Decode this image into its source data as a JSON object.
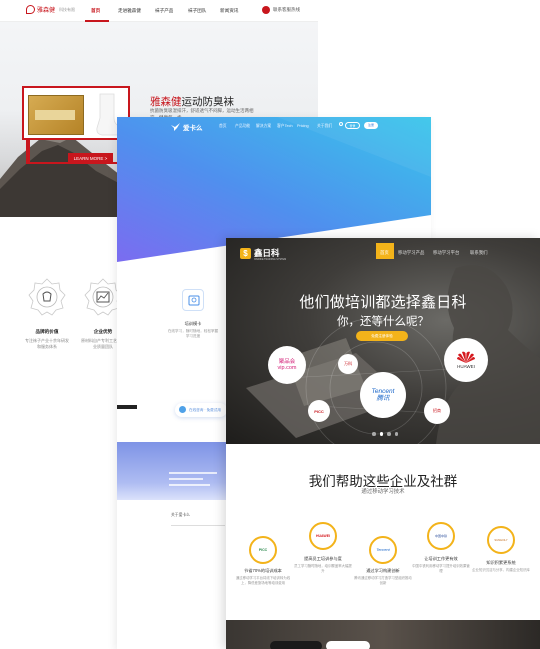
{
  "card1": {
    "logo_text": "雅森健",
    "logo_sub": "科技有限",
    "nav": [
      "首页",
      "走进雅森健",
      "袜子产品",
      "袜子团队",
      "新闻资讯"
    ],
    "hotline": "联系客服热线",
    "hero": {
      "brand": "雅森健",
      "title_rest": "运动防臭袜",
      "desc": "抗菌防臭吸湿排汗，舒适透气不闷脚，运动生活两相宜，健康每一步",
      "button": "LEARN MORE >"
    },
    "features": [
      {
        "title": "品牌的价值",
        "desc": "专注袜子产业十余年研发和服务体系",
        "icon": "socks-icon"
      },
      {
        "title": "企业优势",
        "desc": "原材料自产专利工艺，专业质量团队",
        "icon": "chart-icon"
      }
    ],
    "colors": {
      "accent": "#c8161d"
    }
  },
  "card2": {
    "logo_text": "爱卡么",
    "nav": [
      "首页",
      "产品功能",
      "解决方案",
      "客户Tech",
      "Pricing",
      "关于我们",
      "联系我们"
    ],
    "btn_login": "登录",
    "btn_register": "注册",
    "feature": {
      "title": "培训模卡",
      "desc": "在线学习，随时随地，轻松掌握学习进度"
    },
    "pill": "在线咨询 · 免费试用",
    "footer": "关于爱卡么",
    "colors": {
      "gradient_start": "#7b6cf0",
      "gradient_end": "#38c6ea"
    }
  },
  "card3": {
    "logo_text": "鑫日科",
    "logo_sub": "XINRIKE TRAINING SYSTEM",
    "nav": [
      "首页",
      "移动学习产品",
      "移动学习平台",
      "联系我们"
    ],
    "headline": "他们做培训都选择鑫日科",
    "subheadline": "你，还等什么呢？",
    "cta": "免费注册体验",
    "bubbles": [
      {
        "text": "聚品会\nvip.com",
        "icon": "vipshop-logo"
      },
      {
        "text": "万科",
        "icon": "vanke-logo"
      },
      {
        "text": "Tencent\n腾讯",
        "icon": "tencent-logo"
      },
      {
        "text": "HUAWEI",
        "icon": "huawei-logo"
      },
      {
        "text": "PICC",
        "icon": "picc-logo"
      },
      {
        "text": "招商",
        "icon": "cmb-logo"
      }
    ],
    "section_title": "我们帮助这些企业及社群",
    "section_sub": "通过移动学习技术",
    "clients": [
      {
        "title": "节省70%的培训成本",
        "desc": "通过移动学习平台将线下培训转为线上，降低差旅场地等培训费用",
        "logo": "PICC"
      },
      {
        "title": "提高员工培训参与度",
        "desc": "员工学习随时随地，培训覆盖率大幅提升",
        "logo": "HUAWEI"
      },
      {
        "title": "通过学习构建创新",
        "desc": "腾讯通过移动学习打造学习型组织推动创新",
        "logo": "Tencent"
      },
      {
        "title": "让培训工作更有效",
        "desc": "中国中铁利用移动学习提升培训效果管理",
        "logo": "中国中铁"
      },
      {
        "title": "知识积累更系统",
        "desc": "企业知识沉淀与分享，构建企业知识库",
        "logo": "SUNHOLY"
      }
    ],
    "colors": {
      "accent": "#f3b31a"
    }
  }
}
